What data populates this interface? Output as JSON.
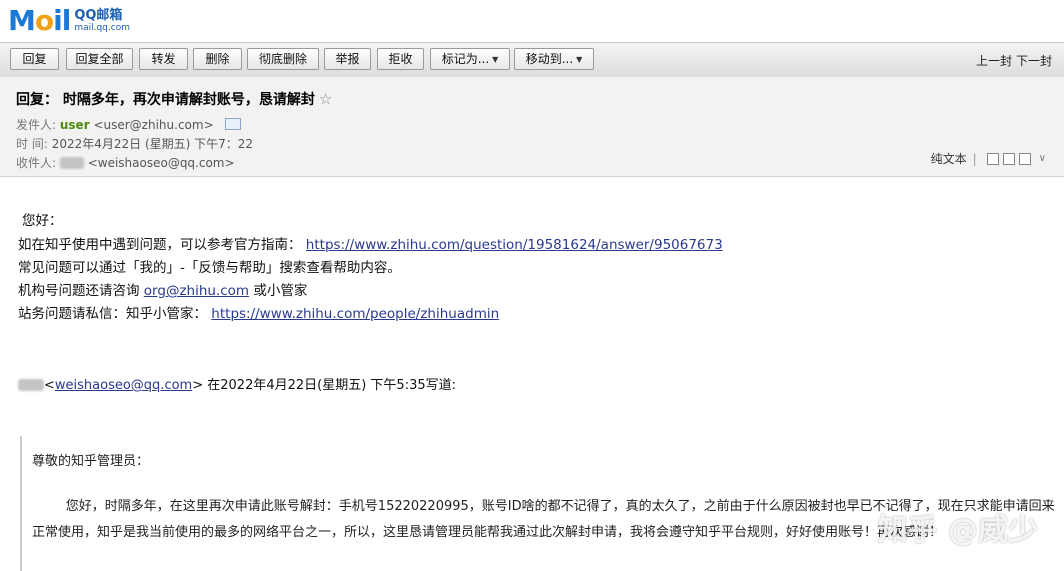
{
  "logo": {
    "word_m": "M",
    "word_o": "o",
    "word_il": "il",
    "cn": "QQ邮箱",
    "en": "mail.qq.com"
  },
  "toolbar": {
    "reply": "回复",
    "reply_all": "回复全部",
    "forward": "转发",
    "delete": "删除",
    "delete_permanent": "彻底删除",
    "report": "举报",
    "reject": "拒收",
    "mark_as": "标记为...",
    "move_to": "移动到...",
    "prev": "上一封",
    "next": "下一封"
  },
  "header": {
    "subject": "回复：   时隔多年，再次申请解封账号，恳请解封",
    "from_label": "发件人:",
    "from_name": "user",
    "from_addr": "<user@zhihu.com>",
    "time_label": "时   间:",
    "time_value": "2022年4月22日 (星期五) 下午7：22",
    "to_label": "收件人:",
    "to_addr": "<weishaoseo@qq.com>",
    "plain_text": "纯文本"
  },
  "body": {
    "greeting": "您好：",
    "line1_text": "如在知乎使用中遇到问题，可以参考官方指南：",
    "line1_link": "https://www.zhihu.com/question/19581624/answer/95067673",
    "line2": "常见问题可以通过「我的」-「反馈与帮助」搜索查看帮助内容。",
    "line3_text": "机构号问题还请咨询",
    "line3_link": "org@zhihu.com",
    "line3_tail": "或小管家",
    "line4_text": "站务问题请私信：知乎小管家：",
    "line4_link": "https://www.zhihu.com/people/zhihuadmin"
  },
  "quote": {
    "addr": "weishaoseo@qq.com",
    "meta": "在2022年4月22日(星期五) 下午5:35写道:",
    "salutation": "尊敬的知乎管理员：",
    "paragraph": "您好，时隔多年，在这里再次申请此账号解封：手机号15220220995，账号ID啥的都不记得了，真的太久了，之前由于什么原因被封也早已不记得了，现在只求能申请回来正常使用，知乎是我当前使用的最多的网络平台之一，所以，这里恳请管理员能帮我通过此次解封申请，我将会遵守知乎平台规则，好好使用账号！再次感谢！"
  },
  "watermark": "知乎 @威少"
}
